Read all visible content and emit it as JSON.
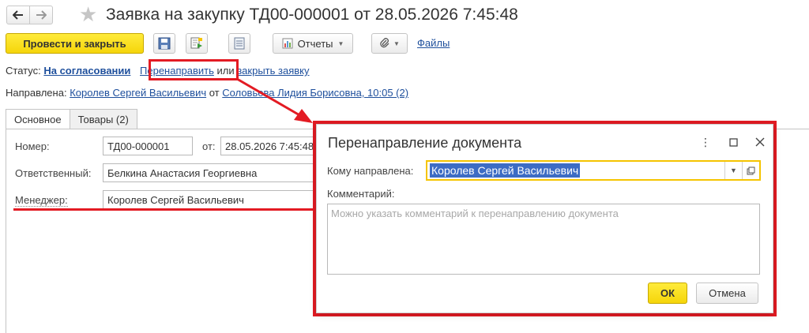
{
  "window": {
    "title": "Заявка на закупку ТД00-000001 от 28.05.2026 7:45:48"
  },
  "toolbar": {
    "post_and_close": "Провести и закрыть",
    "reports": "Отчеты",
    "files": "Файлы"
  },
  "status": {
    "label": "Статус:",
    "value": "На согласовании",
    "redirect": "Перенаправить",
    "or": "или",
    "close_request": "закрыть заявку"
  },
  "directed": {
    "label": "Направлена:",
    "to": "Королев Сергей Васильевич",
    "from_word": "от",
    "from": "Соловьева Лидия Борисовна, 10:05 (2)"
  },
  "tabs": [
    {
      "label": "Основное",
      "active": true
    },
    {
      "label": "Товары (2)",
      "active": false
    }
  ],
  "form": {
    "number_label": "Номер:",
    "number_value": "ТД00-000001",
    "date_label": "от:",
    "date_value": "28.05.2026  7:45:48",
    "responsible_label": "Ответственный:",
    "responsible_value": "Белкина Анастасия Георгиевна",
    "manager_label": "Менеджер:",
    "manager_value": "Королев Сергей Васильевич"
  },
  "dialog": {
    "title": "Перенаправление документа",
    "recipient_label": "Кому направлена:",
    "recipient_value": "Королев Сергей Васильевич",
    "comment_label": "Комментарий:",
    "comment_placeholder": "Можно указать комментарий к перенаправлению документа",
    "ok": "ОК",
    "cancel": "Отмена"
  },
  "colors": {
    "accent_yellow": "#f5d50a",
    "link": "#1e4f9c",
    "annotation_red": "#e31b23",
    "selection": "#3d6cc4"
  }
}
